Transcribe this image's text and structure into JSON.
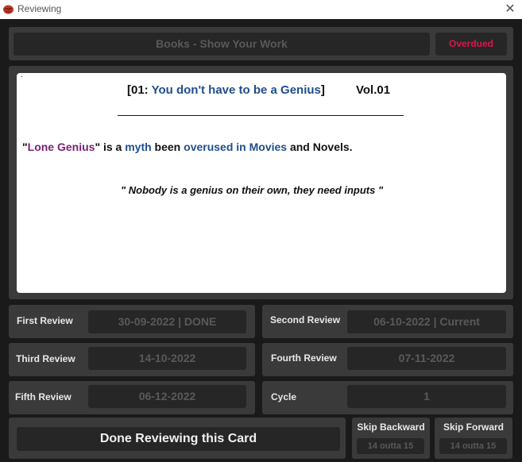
{
  "window": {
    "title": "Reviewing",
    "close_glyph": "✕"
  },
  "header": {
    "book_title": "Books - Show Your Work",
    "status": "Overdued",
    "status_color": "#e0144c"
  },
  "card": {
    "chapter_open": "[01: ",
    "chapter_title": "You don't have to be a Genius",
    "chapter_close": "]",
    "volume": "Vol.01",
    "dot": ".",
    "line_q_open": "\"",
    "line_term": "Lone Genius",
    "line_q_close": "\"",
    "line_is_a": " is a ",
    "line_myth": "myth",
    "line_been": " been ",
    "line_overused": "overused in Movies",
    "line_end": " and Novels.",
    "quote": "\" Nobody is a genius on their own, they need inputs \"",
    "colors": {
      "blue": "#1f4e8c",
      "purple": "#7b1f73"
    }
  },
  "reviews": {
    "first": {
      "label": "First Review",
      "value": "30-09-2022 | DONE"
    },
    "second": {
      "label": "Second Review",
      "value": "06-10-2022 | Current"
    },
    "third": {
      "label": "Third Review",
      "value": "14-10-2022"
    },
    "fourth": {
      "label": "Fourth Review",
      "value": "07-11-2022"
    },
    "fifth": {
      "label": "Fifth Review",
      "value": "06-12-2022"
    },
    "cycle": {
      "label": "Cycle",
      "value": "1"
    }
  },
  "actions": {
    "done_label": "Done Reviewing this Card",
    "skip_backward_label": "Skip Backward",
    "skip_backward_count": "14 outta 15",
    "skip_forward_label": "Skip Forward",
    "skip_forward_count": "14 outta 15"
  }
}
